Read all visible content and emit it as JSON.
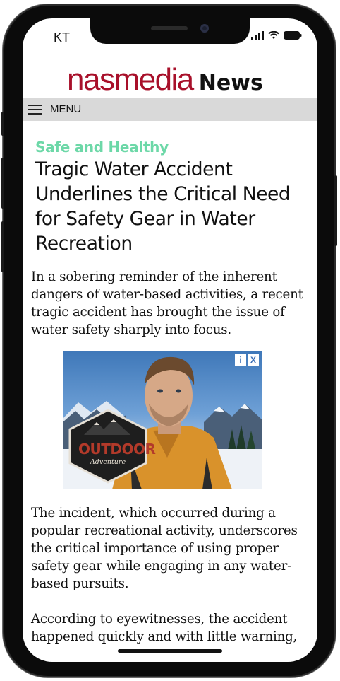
{
  "status_bar": {
    "carrier": "KT",
    "icons": [
      "signal-icon",
      "wifi-icon",
      "battery-icon"
    ]
  },
  "site": {
    "brand": "nasmedia",
    "section_name": "News",
    "brand_color": "#a8102a"
  },
  "nav": {
    "menu_label": "MENU",
    "menu_icon": "hamburger-icon"
  },
  "article": {
    "category": "Safe and Healthy",
    "category_color": "#6dd8a8",
    "headline": "Tragic Water Accident Underlines the Critical Need for Safety Gear in Water Recreation",
    "paragraphs": [
      "In a sobering reminder of the inherent dangers of water-based activities, a recent tragic accident has brought the issue of water safety sharply into focus.",
      "The incident, which occurred during a popular recreational activity, underscores the critical importance of using proper safety gear while engaging in any water-based pursuits.",
      "According to eyewitnesses, the accident happened quickly and with little warning,"
    ]
  },
  "ad": {
    "badge_title": "OUTDOOR",
    "badge_subtitle": "Adventure",
    "info_icon": "info-icon",
    "close_label": "X",
    "info_label": "i"
  }
}
